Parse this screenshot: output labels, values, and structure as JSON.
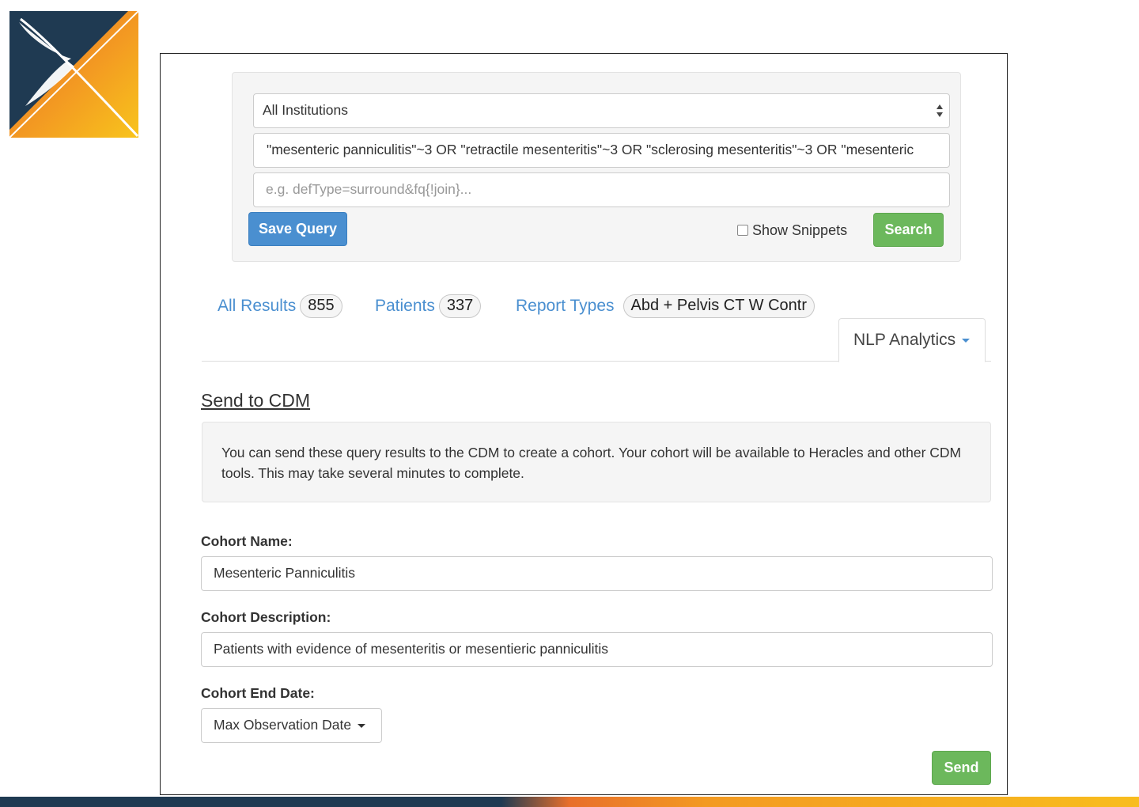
{
  "colors": {
    "primary": "#4a8fd0",
    "success": "#6cb85c",
    "logo_navy": "#1f3a52",
    "logo_orange": "#f39a22",
    "logo_yellow": "#f8bd1e"
  },
  "query_panel": {
    "institution_select": "All Institutions",
    "query_text": "\"mesenteric panniculitis\"~3 OR \"retractile mesenteritis\"~3 OR \"sclerosing mesenteritis\"~3 OR \"mesenteric",
    "params_placeholder": "e.g. defType=surround&fq{!join}...",
    "save_query_label": "Save Query",
    "show_snippets_label": "Show Snippets",
    "search_label": "Search"
  },
  "tabs": {
    "all_results": {
      "label": "All Results",
      "count": "855"
    },
    "patients": {
      "label": "Patients",
      "count": "337"
    },
    "report_types": {
      "label": "Report Types",
      "value": "Abd + Pelvis CT W Contr"
    },
    "nlp_analytics": {
      "label": "NLP Analytics"
    }
  },
  "send_to_cdm": {
    "title": "Send to CDM",
    "info_text": "You can send these query results to the CDM to create a cohort. Your cohort will be available to Heracles and other CDM tools. This may take several minutes to complete.",
    "cohort_name_label": "Cohort Name:",
    "cohort_name_value": "Mesenteric Panniculitis",
    "cohort_description_label": "Cohort Description:",
    "cohort_description_value": "Patients with evidence of mesenteritis or mesentieric panniculitis",
    "cohort_end_date_label": "Cohort End Date:",
    "cohort_end_date_value": "Max Observation Date",
    "send_label": "Send"
  }
}
